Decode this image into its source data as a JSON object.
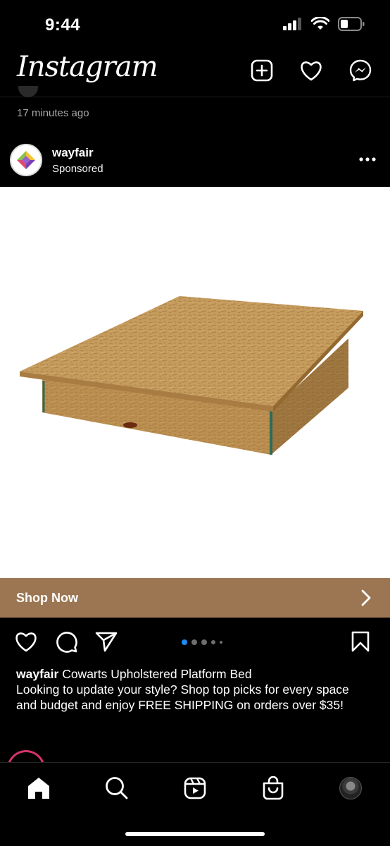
{
  "status_bar": {
    "time": "9:44"
  },
  "header": {
    "logo": "Instagram"
  },
  "previous_post": {
    "timestamp": "17 minutes ago"
  },
  "post": {
    "username": "wayfair",
    "label": "Sponsored",
    "carousel": {
      "total": 5,
      "active_index": 0
    },
    "shop_cta": "Shop Now",
    "caption_user": "wayfair",
    "caption_title": "Cowarts Upholstered Platform Bed",
    "caption_text": "Looking to update your style? Shop top picks for every space and budget and enjoy FREE SHIPPING on orders over $35!"
  },
  "colors": {
    "background": "#000000",
    "shop_bar": "#9c7652",
    "carousel_active": "#1f8cf0",
    "story_ring": "#d6336c"
  },
  "icons": {
    "header": [
      "plus-square-icon",
      "heart-icon",
      "messenger-icon"
    ],
    "actions": [
      "heart-icon",
      "comment-icon",
      "share-icon",
      "bookmark-icon"
    ],
    "nav": [
      "home-icon",
      "search-icon",
      "reels-icon",
      "shop-icon",
      "profile-avatar"
    ]
  }
}
